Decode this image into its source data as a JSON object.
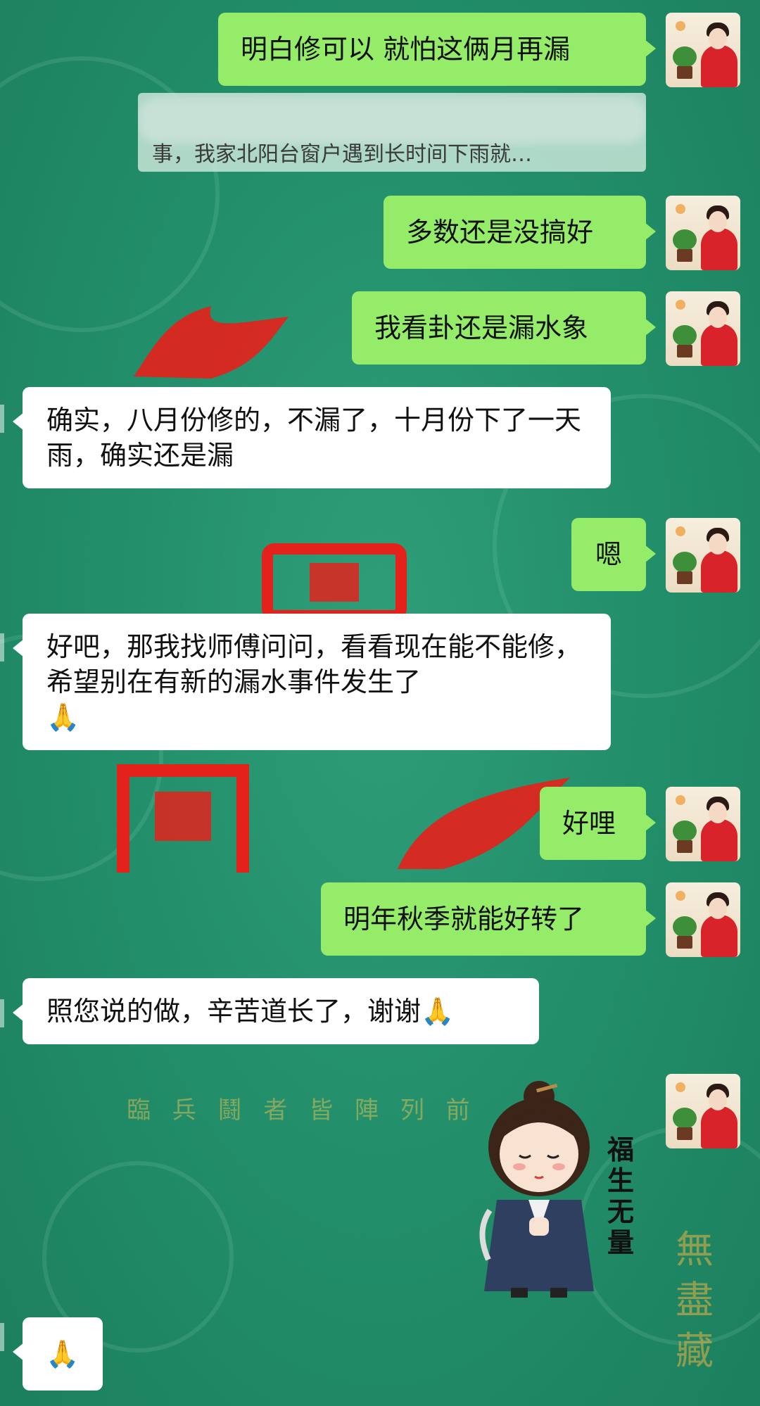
{
  "chat": {
    "messages": [
      {
        "side": "right",
        "text": "明白修可以 就怕这俩月再漏"
      },
      {
        "side": "right",
        "text": "多数还是没搞好"
      },
      {
        "side": "right",
        "text": "我看卦还是漏水象"
      },
      {
        "side": "left",
        "text": "确实，八月份修的，不漏了，十月份下了一天雨，确实还是漏"
      },
      {
        "side": "right",
        "text": "嗯"
      },
      {
        "side": "left",
        "text": "好吧，那我找师傅问问，看看现在能不能修，希望别在有新的漏水事件发生了",
        "emoji": "🙏"
      },
      {
        "side": "right",
        "text": "好哩"
      },
      {
        "side": "right",
        "text": "明年秋季就能好转了"
      },
      {
        "side": "left",
        "text": "照您说的做，辛苦道长了，谢谢",
        "emoji": "🙏"
      },
      {
        "side": "left",
        "text": "",
        "emoji": "🙏"
      }
    ],
    "quoted": {
      "text": "事，我家北阳台窗户遇到长时间下雨就…"
    },
    "sticker": {
      "caption": "福生无量"
    }
  },
  "background": {
    "banner_text": "臨 兵 鬪 者 皆 陣 列 前",
    "corner_text": "無盡藏"
  },
  "colors": {
    "background": "#23906b",
    "outgoing_bubble": "#95ec69",
    "incoming_bubble": "#ffffff",
    "avatar_robe": "#d8232a"
  }
}
